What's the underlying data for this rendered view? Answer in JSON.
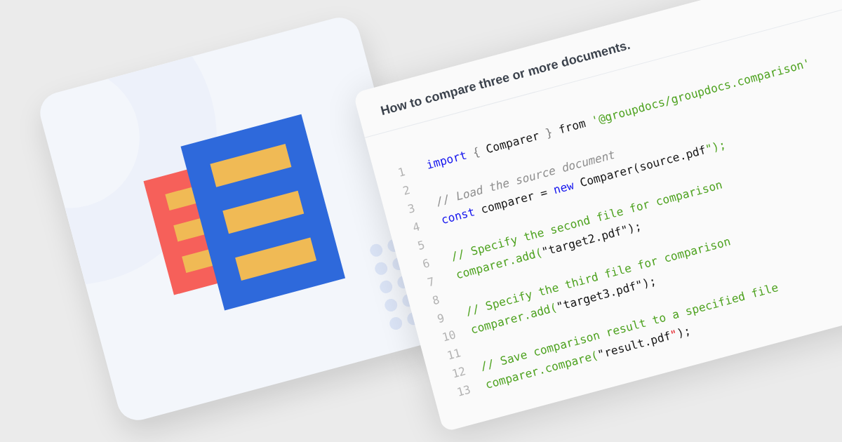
{
  "code_card": {
    "title": "How to compare three or more documents.",
    "lines": [
      {
        "number": "1",
        "tokens": [
          {
            "text": "import",
            "kind": "keyword"
          },
          {
            "text": " {",
            "kind": "punctuation"
          },
          {
            "text": " Comparer ",
            "kind": "plain"
          },
          {
            "text": "}",
            "kind": "punctuation"
          },
          {
            "text": " from ",
            "kind": "plain"
          },
          {
            "text": "'@groupdocs/groupdocs.comparison'",
            "kind": "string"
          }
        ]
      },
      {
        "number": "2"
      },
      {
        "number": "3",
        "tokens": [
          {
            "text": "// Load the source document",
            "kind": "comment"
          }
        ]
      },
      {
        "number": "4",
        "tokens": [
          {
            "text": "const",
            "kind": "keyword"
          },
          {
            "text": " comparer = ",
            "kind": "plain"
          },
          {
            "text": "new",
            "kind": "keyword"
          },
          {
            "text": " Comparer(source.pdf",
            "kind": "plain"
          },
          {
            "text": "\");",
            "kind": "string"
          }
        ]
      },
      {
        "number": "5"
      },
      {
        "number": "6",
        "tokens": [
          {
            "text": "// Specify the second file for comparison",
            "kind": "string"
          }
        ]
      },
      {
        "number": "7",
        "tokens": [
          {
            "text": "comparer.add(",
            "kind": "string"
          },
          {
            "text": "\"target2.pdf\");",
            "kind": "plain"
          }
        ]
      },
      {
        "number": "8"
      },
      {
        "number": "9",
        "tokens": [
          {
            "text": "// Specify the third file for comparison",
            "kind": "string"
          }
        ]
      },
      {
        "number": "10",
        "tokens": [
          {
            "text": "comparer.add(",
            "kind": "string"
          },
          {
            "text": "\"target3.pdf\");",
            "kind": "plain"
          }
        ]
      },
      {
        "number": "11"
      },
      {
        "number": "12",
        "tokens": [
          {
            "text": "// Save comparison result to a specified file",
            "kind": "string"
          }
        ]
      },
      {
        "number": "13",
        "tokens": [
          {
            "text": "comparer.compare(",
            "kind": "string"
          },
          {
            "text": "\"result.pdf",
            "kind": "plain"
          },
          {
            "text": "\"",
            "kind": "error"
          },
          {
            "text": ");",
            "kind": "plain"
          }
        ]
      }
    ]
  }
}
